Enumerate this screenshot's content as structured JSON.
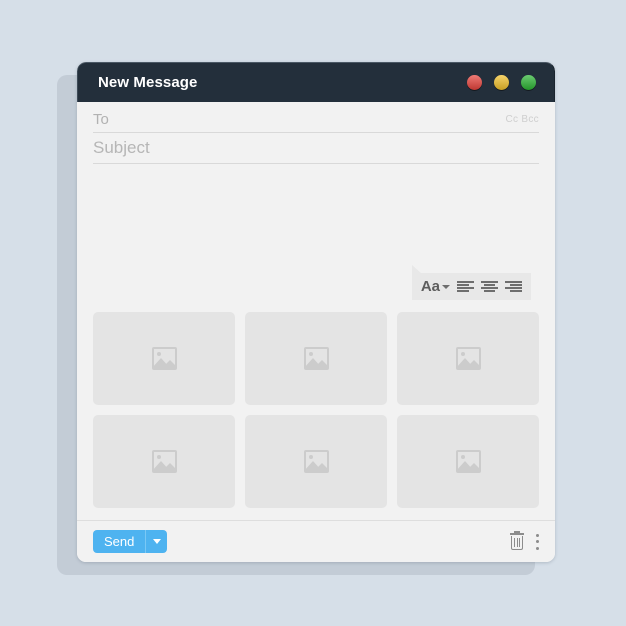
{
  "window": {
    "title": "New Message",
    "controls": [
      {
        "name": "close",
        "color": "#e8433c"
      },
      {
        "name": "minimize",
        "color": "#f2c12b"
      },
      {
        "name": "maximize",
        "color": "#2cb534"
      }
    ]
  },
  "fields": {
    "to": {
      "label": "To",
      "value": "",
      "placeholder": "To"
    },
    "cc_bcc": "Cc Bcc",
    "subject": {
      "label": "Subject",
      "value": "",
      "placeholder": "Subject"
    }
  },
  "format_toolbar": {
    "font_label": "Aa",
    "align_left": "align-left",
    "align_center": "align-center",
    "align_right": "align-right"
  },
  "attachments": {
    "items": [
      {
        "icon": "image-placeholder"
      },
      {
        "icon": "image-placeholder"
      },
      {
        "icon": "image-placeholder"
      },
      {
        "icon": "image-placeholder"
      },
      {
        "icon": "image-placeholder"
      },
      {
        "icon": "image-placeholder"
      }
    ]
  },
  "action_bar": {
    "send_label": "Send",
    "send_color": "#4eb3f0",
    "discard_icon": "trash-icon",
    "more_icon": "kebab-icon"
  },
  "colors": {
    "titlebar": "#232f3b",
    "body": "#f2f2f2",
    "page_background": "#d6dfe8",
    "thumbnail": "#e4e4e4",
    "accent": "#4eb3f0"
  }
}
